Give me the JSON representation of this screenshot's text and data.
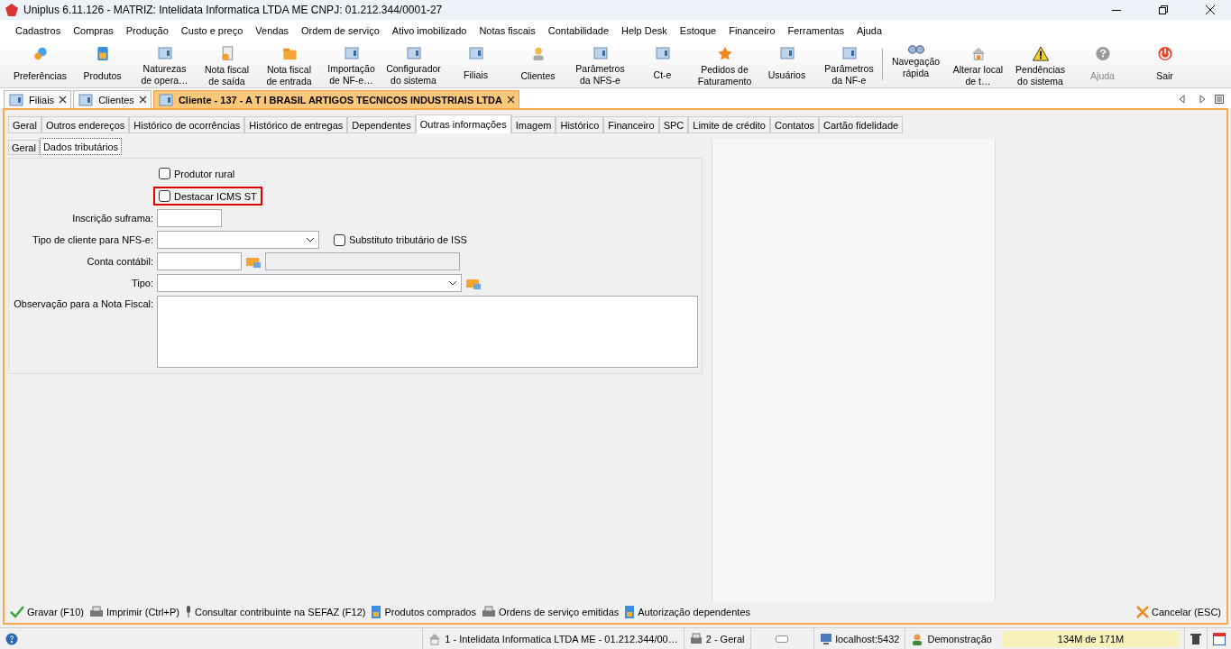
{
  "window": {
    "title": "Uniplus 6.11.126 - MATRIZ: Intelidata Informatica LTDA ME CNPJ: 01.212.344/0001-27"
  },
  "menu": [
    "Cadastros",
    "Compras",
    "Produção",
    "Custo e preço",
    "Vendas",
    "Ordem de serviço",
    "Ativo imobilizado",
    "Notas fiscais",
    "Contabilidade",
    "Help Desk",
    "Estoque",
    "Financeiro",
    "Ferramentas",
    "Ajuda"
  ],
  "toolbar": [
    {
      "label": "Preferências",
      "kind": "gear",
      "disabled": false
    },
    {
      "label": "Produtos",
      "kind": "box",
      "disabled": false
    },
    {
      "label": "Naturezas\nde opera…",
      "kind": "window",
      "disabled": false
    },
    {
      "label": "Nota fiscal\nde saída",
      "kind": "document",
      "disabled": false
    },
    {
      "label": "Nota fiscal\nde entrada",
      "kind": "folder",
      "disabled": false
    },
    {
      "label": "Importação\nde NF-e…",
      "kind": "window",
      "disabled": false
    },
    {
      "label": "Configurador\ndo sistema",
      "kind": "window",
      "disabled": false
    },
    {
      "label": "Filiais",
      "kind": "window",
      "disabled": false
    },
    {
      "label": "Clientes",
      "kind": "person",
      "disabled": false
    },
    {
      "label": "Parâmetros\nda NFS-e",
      "kind": "window",
      "disabled": false
    },
    {
      "label": "Ct-e",
      "kind": "window",
      "disabled": false
    },
    {
      "label": "Pedidos de\nFaturamento",
      "kind": "star",
      "disabled": false
    },
    {
      "label": "Usuários",
      "kind": "window",
      "disabled": false
    },
    {
      "label": "Parâmetros\nda NF-e",
      "kind": "window",
      "disabled": false
    },
    {
      "label": "Navegação\nrápida",
      "kind": "binoculars",
      "disabled": false
    },
    {
      "label": "Alterar local\nde t…",
      "kind": "house",
      "disabled": false
    },
    {
      "label": "Pendências\ndo sistema",
      "kind": "warning",
      "disabled": false
    },
    {
      "label": "Ajuda",
      "kind": "help",
      "disabled": true
    },
    {
      "label": "Sair",
      "kind": "power",
      "disabled": false
    }
  ],
  "doc_tabs": [
    {
      "label": "Filiais",
      "selected": false
    },
    {
      "label": "Clientes",
      "selected": false
    },
    {
      "label": "Cliente - 137 - A T I BRASIL ARTIGOS TECNICOS INDUSTRIAIS LTDA",
      "selected": true
    }
  ],
  "tabs": [
    {
      "label": "Geral",
      "selected": false
    },
    {
      "label": "Outros endereços",
      "selected": false
    },
    {
      "label": "Histórico de ocorrências",
      "selected": false
    },
    {
      "label": "Histórico de entregas",
      "selected": false
    },
    {
      "label": "Dependentes",
      "selected": false
    },
    {
      "label": "Outras informações",
      "selected": true
    },
    {
      "label": "Imagem",
      "selected": false
    },
    {
      "label": "Histórico",
      "selected": false
    },
    {
      "label": "Financeiro",
      "selected": false
    },
    {
      "label": "SPC",
      "selected": false
    },
    {
      "label": "Limite de crédito",
      "selected": false
    },
    {
      "label": "Contatos",
      "selected": false
    },
    {
      "label": "Cartão fidelidade",
      "selected": false
    }
  ],
  "sub_tabs": [
    {
      "label": "Geral",
      "selected": false
    },
    {
      "label": "Dados tributários",
      "selected": true
    }
  ],
  "form": {
    "checkboxes": [
      {
        "label": "Produtor rural",
        "checked": false,
        "highlighted": false
      },
      {
        "label": "Destacar ICMS ST",
        "checked": false,
        "highlighted": true
      }
    ],
    "inscricao_suframa": {
      "label": "Inscrição suframa:"
    },
    "tipo_cliente_nfse": {
      "label": "Tipo de cliente para NFS-e:",
      "option": {
        "label": "Substituto tributário de ISS",
        "checked": false
      }
    },
    "conta_contabil": {
      "label": "Conta contábil:"
    },
    "tipo": {
      "label": "Tipo:"
    },
    "observacao": {
      "label": "Observação para a Nota Fiscal:"
    }
  },
  "actions": [
    {
      "label": "Gravar (F10)",
      "kind": "check"
    },
    {
      "label": "Imprimir (Ctrl+P)",
      "kind": "printer"
    },
    {
      "label": "Consultar contribuinte na SEFAZ (F12)",
      "kind": "mic"
    },
    {
      "label": "Produtos comprados",
      "kind": "doc"
    },
    {
      "label": "Ordens de serviço emitidas",
      "kind": "printer"
    },
    {
      "label": "Autorização dependentes",
      "kind": "doc"
    }
  ],
  "cancel": {
    "label": "Cancelar (ESC)"
  },
  "status_bar": {
    "company": "1 - Intelidata Informatica LTDA ME - 01.212.344/00…",
    "branch": "2 - Geral",
    "server": "localhost:5432",
    "user": "Demonstração",
    "memory": "134M de 171M"
  }
}
